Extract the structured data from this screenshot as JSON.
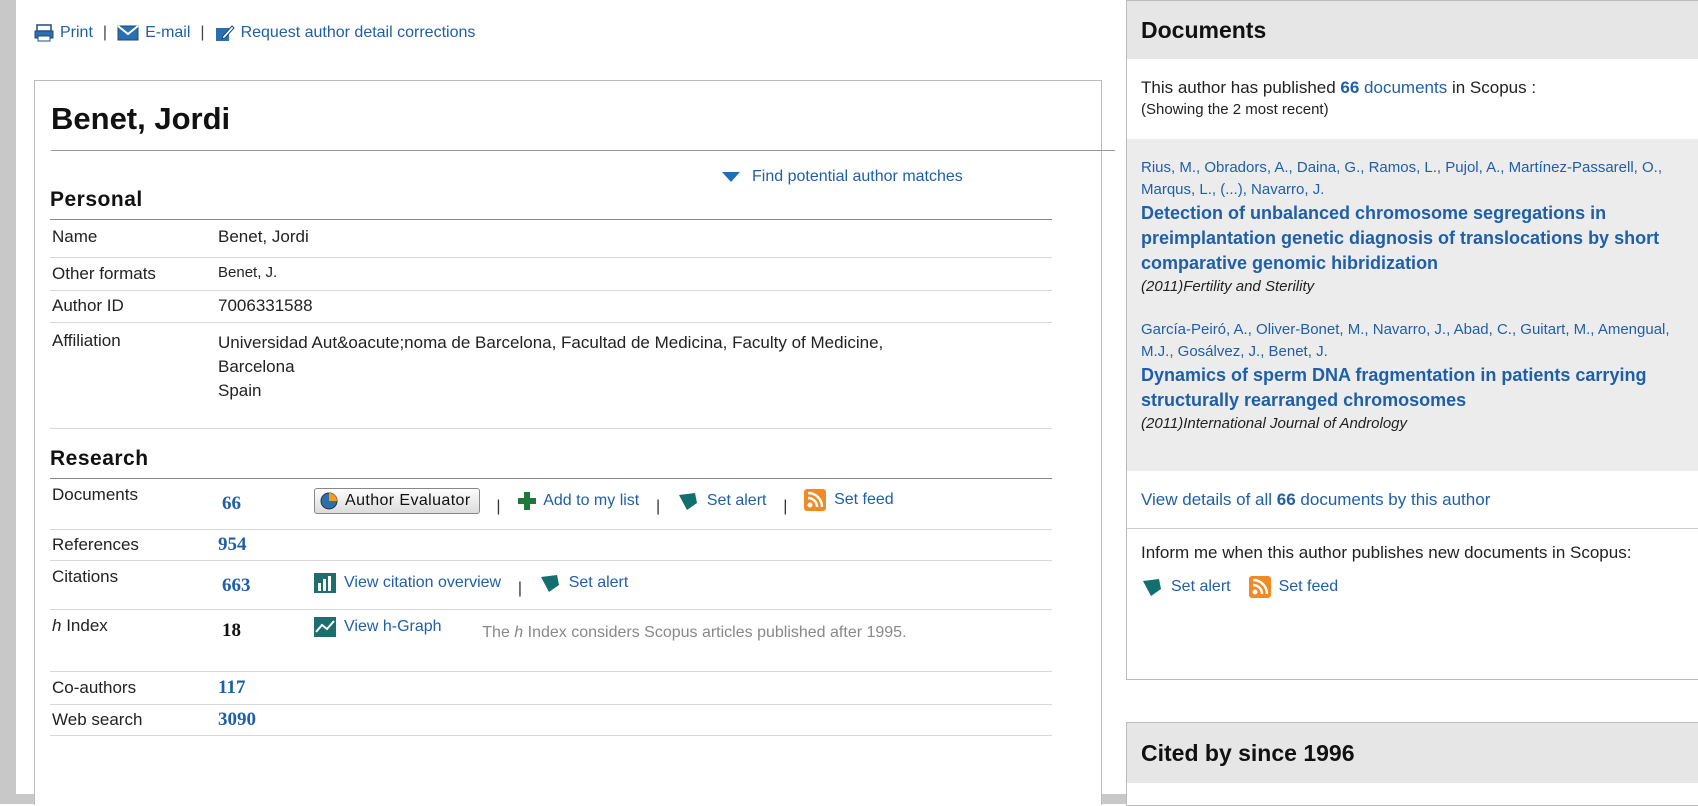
{
  "toolbar": {
    "print": "Print",
    "email": "E-mail",
    "request": "Request author detail corrections",
    "separator": "|"
  },
  "profile": {
    "name": "Benet, Jordi",
    "find_matches": "Find potential author matches",
    "personal": {
      "title": "Personal",
      "rows": [
        {
          "key": "Name",
          "value": "Benet, Jordi"
        },
        {
          "key": "Other formats",
          "value": "Benet, J."
        },
        {
          "key": "Author ID",
          "value": "7006331588"
        },
        {
          "key": "Affiliation",
          "value": [
            "Universidad Aut&oacute;noma de Barcelona, Facultad de Medicina, Faculty of Medicine,",
            "Barcelona",
            "Spain"
          ]
        }
      ]
    },
    "research": {
      "title": "Research",
      "documents": {
        "key": "Documents",
        "value": "66",
        "author_evaluator": "Author Evaluator",
        "add_list": "Add to my list",
        "set_alert": "Set alert",
        "set_feed": "Set feed"
      },
      "references": {
        "key": "References",
        "value": "954"
      },
      "citations": {
        "key": "Citations",
        "value": "663",
        "view_overview": "View citation overview",
        "set_alert": "Set alert"
      },
      "hindex": {
        "key_italic": "h",
        "key_rest": " Index",
        "value": "18",
        "view_graph": "View h-Graph",
        "note_pre": "The ",
        "note_italic": "h",
        "note_post": " Index considers Scopus articles published after 1995."
      },
      "coauthors": {
        "key": "Co-authors",
        "value": "117"
      },
      "websearch": {
        "key": "Web search",
        "value": "3090"
      }
    }
  },
  "documents_panel": {
    "title": "Documents",
    "intro_pre": "This author has published ",
    "intro_count": "66",
    "intro_link": " documents",
    "intro_post": " in Scopus :",
    "intro_sub": "(Showing the 2 most recent)",
    "docs": [
      {
        "authors": "Rius, M., Obradors, A., Daina, G., Ramos, L., Pujol, A., Martínez-Passarell, O., Marqus, L., (...), Navarro, J.",
        "title": "Detection of unbalanced chromosome segregations in preimplantation genetic diagnosis of translocations by short comparative genomic hibridization",
        "source": "(2011)Fertility and Sterility"
      },
      {
        "authors": "García-Peiró, A., Oliver-Bonet, M., Navarro, J., Abad, C., Guitart, M., Amengual, M.J., Gosálvez, J., Benet, J.",
        "title": "Dynamics of sperm DNA fragmentation in patients carrying structurally rearranged chromosomes",
        "source": "(2011)International Journal of Andrology"
      }
    ],
    "view_all_pre": "View details of all ",
    "view_all_count": "66",
    "view_all_post": " documents by this author",
    "inform_text": "Inform me when this author publishes new documents in Scopus:",
    "set_alert": "Set alert",
    "set_feed": "Set feed"
  },
  "cited_panel": {
    "title": "Cited by since 1996"
  },
  "colors": {
    "link": "#1f5fa8",
    "header_bg": "#e6e6e6",
    "frame": "#c8c8c8",
    "rss": "#f08a24",
    "alert": "#136e6e"
  }
}
